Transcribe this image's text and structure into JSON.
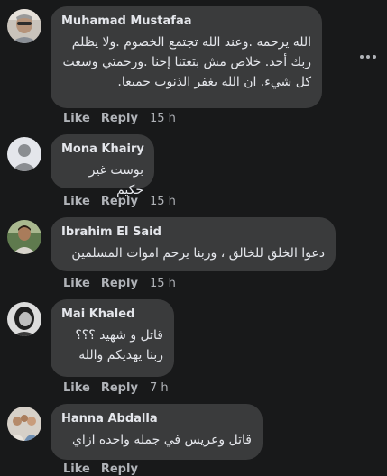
{
  "comments": [
    {
      "author": "Muhamad Mustafaa",
      "text": "الله يرحمه .وعند الله تجتمع الخصوم .ولا يظلم\nربك أحد. خلاص مش بتعتنا إحنا .ورحمتي وسعت\nكل شيء. ان الله يغفر الذنوب جميعا.",
      "like": "Like",
      "reply": "Reply",
      "time": "15 h",
      "avatar": "avatar-photo-man-glasses"
    },
    {
      "author": "Mona Khairy",
      "text": "بوست غير حكيم",
      "like": "Like",
      "reply": "Reply",
      "time": "15 h",
      "avatar": "default-avatar-silhouette"
    },
    {
      "author": "Ibrahim El Said",
      "text": "دعوا الخلق للخالق ، وربنا يرحم اموات المسلمين",
      "like": "Like",
      "reply": "Reply",
      "time": "15 h",
      "avatar": "avatar-photo-man-outdoor"
    },
    {
      "author": "Mai Khaled",
      "text": "قاتل و شهيد ؟؟؟\nربنا يهديكم والله",
      "like": "Like",
      "reply": "Reply",
      "time": "7 h",
      "avatar": "avatar-photo-woman-bw"
    },
    {
      "author": "Hanna Abdalla",
      "text": "قاتل وعريس في جمله واحده ازاي",
      "like": "Like",
      "reply": "Reply",
      "time": "",
      "avatar": "avatar-photo-group"
    }
  ],
  "colors": {
    "background": "#18191a",
    "bubble": "#3a3b3c",
    "text": "#e4e6eb",
    "secondary": "#b0b3b8"
  },
  "icons": {
    "more": "more-options-horizontal-dots-icon"
  }
}
